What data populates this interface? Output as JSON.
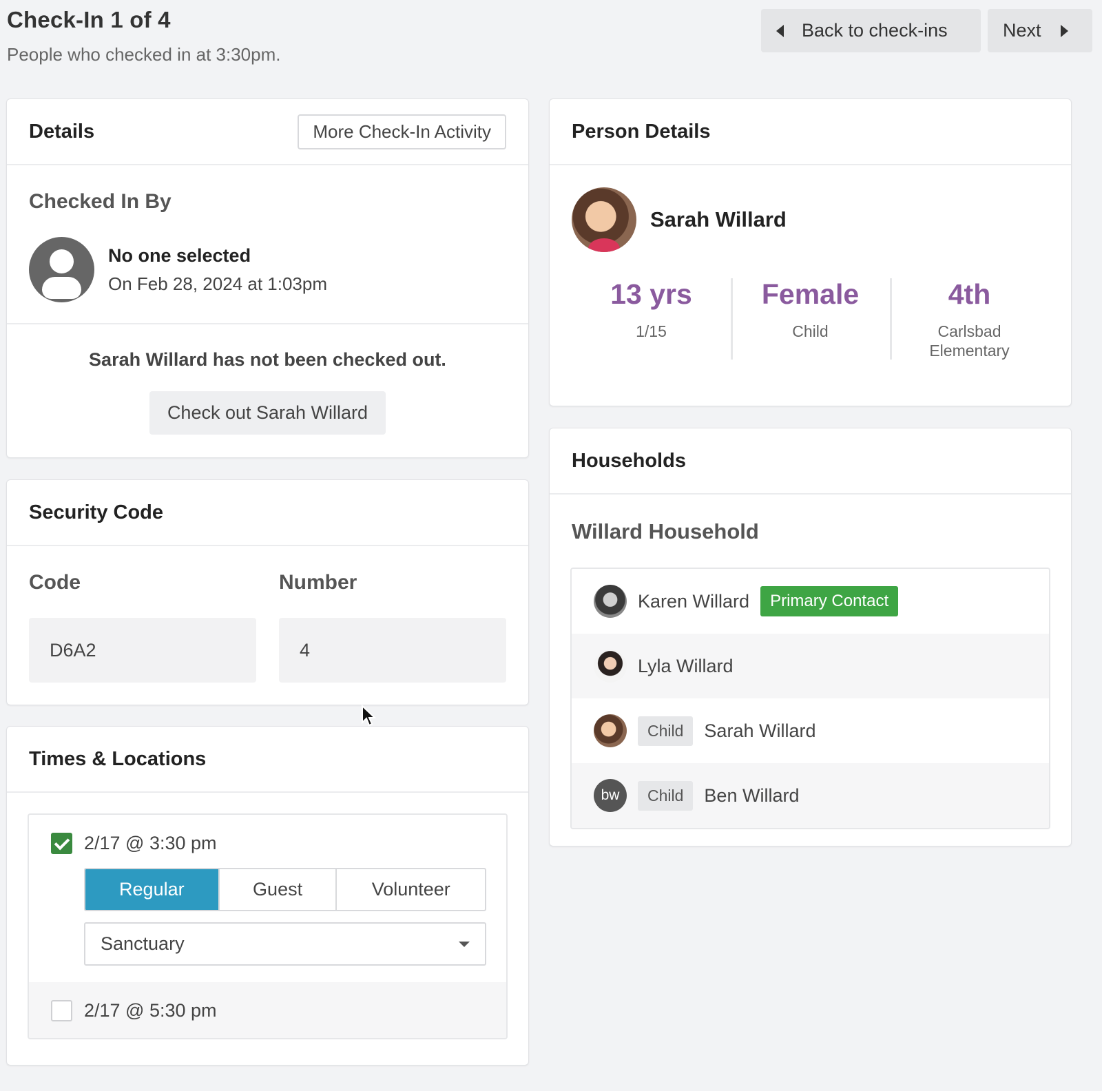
{
  "header": {
    "title": "Check-In 1 of 4",
    "subtitle": "People who checked in at 3:30pm.",
    "back_label": "Back to check-ins",
    "next_label": "Next"
  },
  "details": {
    "title": "Details",
    "activity_button": "More Check-In Activity",
    "checked_in_by_label": "Checked In By",
    "checker_name": "No one selected",
    "checker_date": "On Feb 28, 2024 at 1:03pm",
    "checkout_message": "Sarah Willard has not been checked out.",
    "checkout_button": "Check out Sarah Willard"
  },
  "security": {
    "title": "Security Code",
    "code_label": "Code",
    "code_value": "D6A2",
    "number_label": "Number",
    "number_value": "4"
  },
  "times": {
    "title": "Times & Locations",
    "entries": [
      {
        "label": "2/17 @ 3:30 pm",
        "checked": true,
        "kinds": [
          "Regular",
          "Guest",
          "Volunteer"
        ],
        "selected_kind": "Regular",
        "location": "Sanctuary"
      },
      {
        "label": "2/17 @ 5:30 pm",
        "checked": false
      }
    ]
  },
  "person": {
    "title": "Person Details",
    "name": "Sarah Willard",
    "stats": [
      {
        "value": "13 yrs",
        "sub": "1/15"
      },
      {
        "value": "Female",
        "sub": "Child"
      },
      {
        "value": "4th",
        "sub": "Carlsbad Elementary"
      }
    ],
    "accent_color": "#8a5a9e"
  },
  "households": {
    "title": "Households",
    "household_name": "Willard Household",
    "members": [
      {
        "name": "Karen Willard",
        "badge": "Primary Contact",
        "avatar": "photo-avatar"
      },
      {
        "name": "Lyla Willard",
        "badge": "",
        "avatar": "photo-avatar"
      },
      {
        "name": "Sarah Willard",
        "badge": "Child",
        "avatar": "photo-avatar"
      },
      {
        "name": "Ben Willard",
        "badge": "Child",
        "avatar": "bw"
      }
    ]
  },
  "colors": {
    "segment_active": "#2d9ac1",
    "checkbox_green": "#3a8a3f",
    "primary_badge": "#3ea544"
  }
}
